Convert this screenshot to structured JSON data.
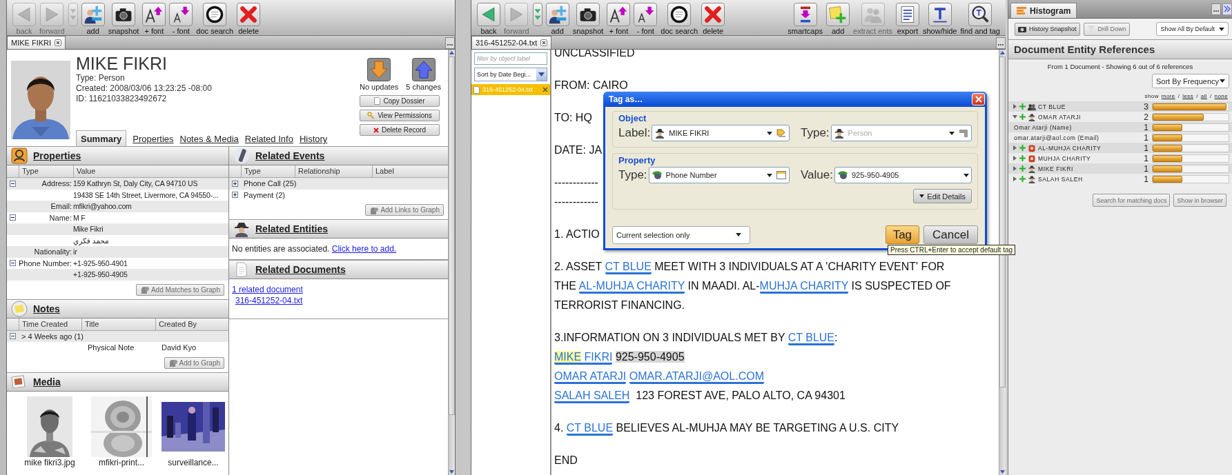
{
  "left_window": {
    "toolbar": [
      {
        "label": "back",
        "kind": "back",
        "disabled": true
      },
      {
        "label": "forward",
        "kind": "forward",
        "disabled": true
      },
      {
        "kind": "history",
        "disabled": true
      },
      {
        "label": "add",
        "kind": "add",
        "disabled": false
      },
      {
        "label": "snapshot",
        "kind": "snapshot",
        "disabled": false
      },
      {
        "label": "+ font",
        "kind": "fontup",
        "disabled": false
      },
      {
        "label": "- font",
        "kind": "fontdown",
        "disabled": false
      },
      {
        "label": "doc search",
        "kind": "docsearch",
        "disabled": false
      },
      {
        "label": "delete",
        "kind": "delete",
        "disabled": false
      }
    ],
    "tabs": [
      {
        "label": "MIKE FIKRI",
        "selected": true
      }
    ],
    "dossier": {
      "name": "MIKE FIKRI",
      "type": "Type: Person",
      "created": "Created: 2008/03/06 13:23:25 -08:00",
      "id": "ID: 11621033823492672",
      "status": [
        {
          "label": "No updates"
        },
        {
          "label": "5 changes"
        }
      ],
      "actions": [
        {
          "label": "Copy Dossier"
        },
        {
          "label": "View Permissions"
        },
        {
          "label": "Delete Record"
        }
      ],
      "tabs": [
        {
          "label": "Summary",
          "selected": true
        },
        {
          "label": "Properties",
          "selected": false
        },
        {
          "label": "Notes & Media",
          "selected": false
        },
        {
          "label": "Related Info",
          "selected": false
        },
        {
          "label": "History",
          "selected": false
        }
      ]
    },
    "properties": {
      "title": "Properties",
      "columns": [
        "Type",
        "Value"
      ],
      "rows": [
        {
          "type": "Address:",
          "expanded": true,
          "values": [
            "159 Kathryn St, Daly City, CA 94710 US",
            "19438 SE 14th Street, Livermore, CA 94550-..."
          ]
        },
        {
          "type": "Email:",
          "values": [
            "mfikri@yahoo.com"
          ]
        },
        {
          "type": "Name:",
          "expanded": true,
          "values": [
            "M F",
            "Mike Fikri",
            "محمد فكري"
          ]
        },
        {
          "type": "Nationality:",
          "values": [
            "ir"
          ]
        },
        {
          "type": "Phone Number:",
          "expanded": true,
          "values": [
            "+1-925-950-4901",
            "+1-925-950-4905"
          ]
        }
      ],
      "button": {
        "label": "Add Matches to Graph",
        "disabled": true
      }
    },
    "notes": {
      "title": "Notes",
      "columns": [
        "Time Created",
        "Title",
        "Created By"
      ],
      "groups": [
        {
          "label": "> 4 Weeks ago (1)",
          "expanded": true,
          "rows": [
            {
              "title": "Physical Note",
              "created_by": "David Kyo"
            }
          ]
        }
      ],
      "button": {
        "label": "Add to Graph",
        "disabled": true
      }
    },
    "media": {
      "title": "Media",
      "items": [
        {
          "caption": "mike fikri3.jpg",
          "kind": "picture"
        },
        {
          "caption": "mfikri-print...",
          "kind": "picture"
        },
        {
          "caption": "surveillance...",
          "kind": "picture"
        }
      ]
    },
    "related_events": {
      "title": "Related Events",
      "columns": [
        "Type",
        "Relationship",
        "Label"
      ],
      "rows": [
        {
          "type": "Phone Call (25)",
          "expanded": false
        },
        {
          "type": "Payment (2)",
          "expanded": false
        }
      ],
      "button": {
        "label": "Add Links to Graph",
        "disabled": true
      }
    },
    "related_entities": {
      "title": "Related Entities",
      "text": "No entities are associated.",
      "link": "Click here to add."
    },
    "related_documents": {
      "title": "Related Documents",
      "links": [
        "1 related document",
        "316-451252-04.txt"
      ]
    }
  },
  "doc_window": {
    "toolbar": {
      "main": [
        {
          "label": "back",
          "kind": "back",
          "disabled": false
        },
        {
          "label": "forward",
          "kind": "forward",
          "disabled": true
        },
        {
          "kind": "history",
          "disabled": false
        },
        {
          "label": "add",
          "kind": "add",
          "disabled": false
        },
        {
          "label": "snapshot",
          "kind": "snapshot",
          "disabled": false
        },
        {
          "label": "+ font",
          "kind": "fontup",
          "disabled": false
        },
        {
          "label": "- font",
          "kind": "fontdown",
          "disabled": false
        },
        {
          "label": "doc search",
          "kind": "docsearch",
          "disabled": false
        },
        {
          "label": "delete",
          "kind": "delete",
          "disabled": false
        }
      ],
      "tools": [
        {
          "label": "smartcaps",
          "kind": "smartcaps",
          "disabled": false
        },
        {
          "label": "add",
          "kind": "note",
          "disabled": false
        },
        {
          "label": "extract ents",
          "kind": "extract",
          "disabled": true
        },
        {
          "label": "export",
          "kind": "export",
          "disabled": false
        },
        {
          "label": "show/hide",
          "kind": "showhide",
          "disabled": false
        },
        {
          "label": "find and tag",
          "kind": "findtag",
          "disabled": false
        }
      ]
    },
    "tabs": [
      {
        "label": "316-451252-04.txt",
        "selected": true
      }
    ],
    "filter": {
      "placeholder": "filter by object label"
    },
    "sort": "Sort by Date Begi...",
    "documents": [
      {
        "label": "316-451252-04.txt",
        "selected": true
      }
    ],
    "paragraphs": [
      {
        "lines": [
          [
            {
              "text": "UNCLASSIFIED",
              "kind": "plain"
            }
          ]
        ]
      },
      {
        "lines": [
          [
            {
              "text": "FROM: CAIRO",
              "kind": "plain"
            }
          ]
        ]
      },
      {
        "lines": [
          [
            {
              "text": "TO: HQ",
              "kind": "plain"
            }
          ]
        ]
      },
      {
        "lines": [
          [
            {
              "text": "DATE: JA",
              "kind": "plain"
            }
          ]
        ]
      },
      {
        "lines": [
          [
            {
              "text": "------------",
              "kind": "plain"
            }
          ],
          [
            {
              "text": "------------",
              "kind": "plain"
            }
          ]
        ]
      },
      {
        "lines": [
          [
            {
              "text": "1. ACTIO",
              "kind": "plain"
            }
          ]
        ]
      },
      {
        "lines": [
          [
            {
              "text": "2. ASSET ",
              "kind": "plain"
            },
            {
              "text": "CT BLUE",
              "kind": "entity"
            },
            {
              "text": " MEET WITH 3 INDIVIDUALS AT A 'CHARITY EVENT' FOR",
              "kind": "plain"
            }
          ],
          [
            {
              "text": "THE ",
              "kind": "plain"
            },
            {
              "text": "AL-MUHJA CHARITY",
              "kind": "entity"
            },
            {
              "text": " IN MAADI. AL-",
              "kind": "plain"
            },
            {
              "text": "MUHJA CHARITY",
              "kind": "entity"
            },
            {
              "text": " IS SUSPECTED OF",
              "kind": "plain"
            }
          ],
          [
            {
              "text": "TERRORIST FINANCING.",
              "kind": "plain"
            }
          ]
        ]
      },
      {
        "lines": [
          [
            {
              "text": "3.INFORMATION ON 3 INDIVIDUALS MET BY ",
              "kind": "plain"
            },
            {
              "text": "CT BLUE",
              "kind": "entity"
            },
            {
              "text": ":",
              "kind": "plain"
            }
          ],
          [
            {
              "kind": "entity",
              "parts": [
                {
                  "text": "MIKE",
                  "kind": "highlight"
                },
                {
                  "text": " FIKRI",
                  "kind": "plain"
                }
              ]
            },
            {
              "text": " 925-950-4905",
              "kind": "selection"
            }
          ],
          [
            {
              "text": "OMAR ATARJI",
              "kind": "entity"
            },
            {
              "text": " OMAR.ATARJI@AOL.COM",
              "kind": "entity"
            }
          ],
          [
            {
              "text": "SALAH SALEH",
              "kind": "entity"
            },
            {
              "text": "  123 FOREST AVE, PALO ALTO, CA 94301",
              "kind": "plain"
            }
          ]
        ]
      },
      {
        "lines": [
          [
            {
              "text": "4. ",
              "kind": "plain"
            },
            {
              "text": "CT BLUE",
              "kind": "entity"
            },
            {
              "text": " BELIEVES AL-MUHJA MAY BE TARGETING A U.S. CITY",
              "kind": "plain"
            }
          ]
        ]
      },
      {
        "lines": [
          [
            {
              "text": "END",
              "kind": "plain"
            }
          ]
        ]
      }
    ]
  },
  "tag_dialog": {
    "title": "Tag as…",
    "groups": [
      {
        "title": "Object",
        "fields": [
          {
            "label": "Label:",
            "value": "MIKE FIKRI",
            "disabled": false
          },
          {
            "label": "Type:",
            "value": "Person",
            "disabled": true
          }
        ]
      },
      {
        "title": "Property",
        "fields": [
          {
            "label": "Type:",
            "value": "Phone Number",
            "disabled": false
          },
          {
            "label": "Value:",
            "value": "925-950-4905",
            "disabled": false
          }
        ],
        "button": "Edit Details"
      }
    ],
    "scope": "Current selection only",
    "buttons": [
      {
        "label": "Tag",
        "default": true
      },
      {
        "label": "Cancel",
        "default": false
      }
    ]
  },
  "tooltip": "Press CTRL+Enter to accept default tag",
  "histogram": {
    "tab": "Histogram",
    "buttons": [
      {
        "label": "History Snapshot",
        "disabled": false
      },
      {
        "label": "Drill Down",
        "disabled": true
      }
    ],
    "view": "Show All By Default",
    "title": "Document Entity References",
    "subtitle": "From 1 Document - Showing 6 out of 6 references",
    "sort": "Sort By Frequency",
    "show": {
      "label": "show",
      "separator": "/",
      "links": [
        "more",
        "less",
        "all",
        "none"
      ]
    },
    "rows": [
      {
        "label": "CT BLUE",
        "kind": "group",
        "count": "3",
        "level": 0.97,
        "expanded": false
      },
      {
        "label": "OMAR ATARJI",
        "kind": "person",
        "count": "2",
        "level": 0.67,
        "expanded": true,
        "children": [
          {
            "label": "Omar Atarji (Name)",
            "count": "1",
            "level": 0.39
          },
          {
            "label": "omar.atarji@aol.com (Email)",
            "count": "1",
            "level": 0.39
          }
        ]
      },
      {
        "label": "AL-MUHJA CHARITY",
        "kind": "organization",
        "count": "1",
        "level": 0.39,
        "expanded": false
      },
      {
        "label": "MUHJA CHARITY",
        "kind": "organization",
        "count": "1",
        "level": 0.39,
        "expanded": false
      },
      {
        "label": "MIKE FIKRI",
        "kind": "person",
        "count": "1",
        "level": 0.39,
        "expanded": false
      },
      {
        "label": "SALAH SALEH",
        "kind": "person",
        "count": "1",
        "level": 0.39,
        "expanded": false
      }
    ],
    "actions": [
      {
        "label": "Search for matching docs",
        "disabled": true
      },
      {
        "label": "Show in browser",
        "disabled": true
      }
    ]
  }
}
